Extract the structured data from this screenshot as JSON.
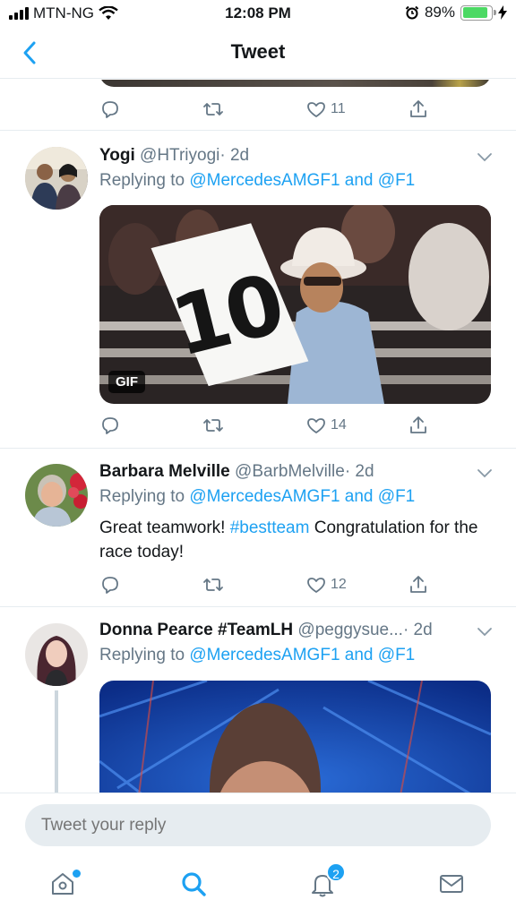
{
  "status_bar": {
    "carrier": "MTN-NG",
    "time": "12:08 PM",
    "battery": "89%",
    "battery_level": 0.89
  },
  "nav": {
    "title": "Tweet"
  },
  "top_tweet": {
    "likes": "11"
  },
  "tweets": [
    {
      "name": "Yogi",
      "handle": "@HTriyogi",
      "time": "· 2d",
      "replying_prefix": "Replying to",
      "mention1": "@MercedesAMGF1",
      "and": "and",
      "mention2": "@F1",
      "media_badge": "GIF",
      "sign_text": "10",
      "likes": "14"
    },
    {
      "name": "Barbara Melville",
      "handle": "@BarbMelville",
      "time": "· 2d",
      "replying_prefix": "Replying to",
      "mention1": "@MercedesAMGF1",
      "and": "and",
      "mention2": "@F1",
      "text_before": "Great teamwork! ",
      "hashtag": "#bestteam",
      "text_after": " Congratulation for the race today!",
      "likes": "12"
    },
    {
      "name": "Donna Pearce #TeamLH",
      "handle": "@peggysue...",
      "time": "· 2d",
      "replying_prefix": "Replying to",
      "mention1": "@MercedesAMGF1",
      "and": "and",
      "mention2": "@F1"
    }
  ],
  "reply": {
    "placeholder": "Tweet your reply"
  },
  "tab_bar": {
    "notifications_count": "2"
  },
  "colors": {
    "accent": "#1da1f2",
    "muted": "#657786",
    "divider": "#e6ecf0"
  }
}
